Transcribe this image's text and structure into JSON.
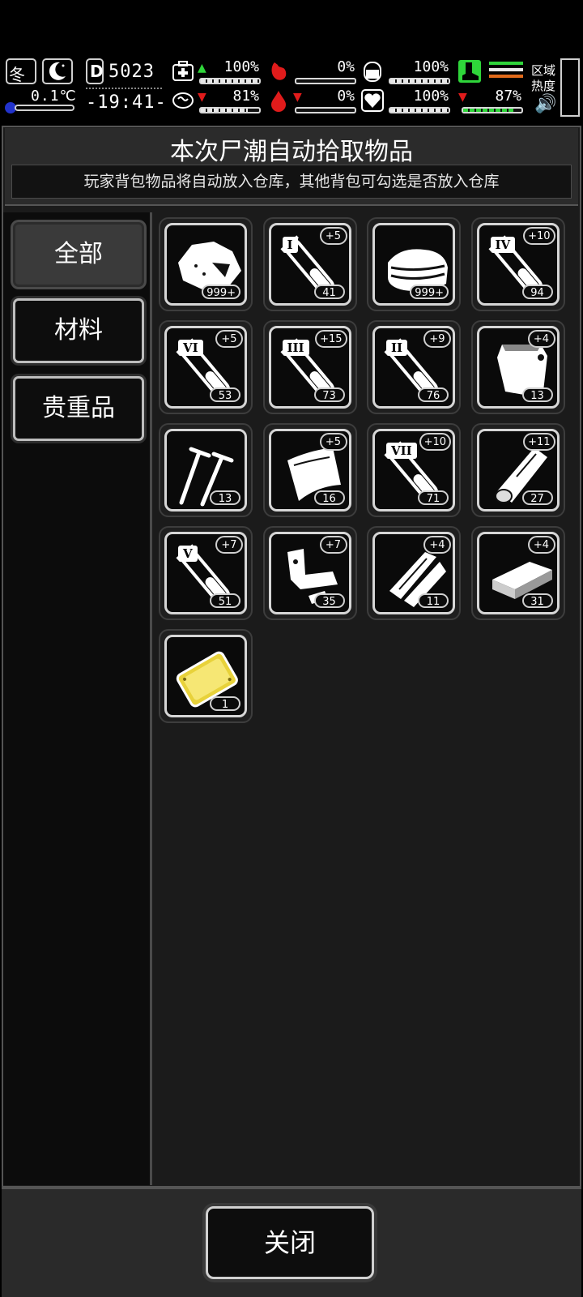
{
  "hud": {
    "season": "冬",
    "temperature": "0.1℃",
    "day": "5023",
    "time": "-19:41-",
    "stats": [
      {
        "name": "health",
        "value": "100%",
        "fill": 1.0,
        "trend": "up"
      },
      {
        "name": "stomach",
        "value": "0%",
        "fill": 0.0,
        "trend": ""
      },
      {
        "name": "hydration-tank",
        "value": "100%",
        "fill": 1.0,
        "trend": ""
      },
      {
        "name": "brain",
        "value": "81%",
        "fill": 0.81,
        "trend": "down"
      },
      {
        "name": "blood",
        "value": "0%",
        "fill": 0.0,
        "trend": "down"
      },
      {
        "name": "heart",
        "value": "100%",
        "fill": 1.0,
        "trend": ""
      },
      {
        "name": "stamina",
        "value": "87%",
        "fill": 0.87,
        "trend": "down"
      }
    ],
    "region_heat_label": "区域热度"
  },
  "dialog": {
    "title": "本次尸潮自动拾取物品",
    "subtitle": "玩家背包物品将自动放入仓库，其他背包可勾选是否放入仓库"
  },
  "tabs": [
    {
      "label": "全部",
      "active": true
    },
    {
      "label": "材料",
      "active": false
    },
    {
      "label": "贵重品",
      "active": false
    }
  ],
  "items": [
    {
      "icon": "rock-lump-icon",
      "count": "999+",
      "plus": "",
      "roman": ""
    },
    {
      "icon": "test-tube-icon",
      "count": "41",
      "plus": "+5",
      "roman": "I"
    },
    {
      "icon": "cloth-stack-icon",
      "count": "999+",
      "plus": "",
      "roman": ""
    },
    {
      "icon": "test-tube-icon",
      "count": "94",
      "plus": "+10",
      "roman": "IV"
    },
    {
      "icon": "test-tube-icon",
      "count": "53",
      "plus": "+5",
      "roman": "VI"
    },
    {
      "icon": "test-tube-icon",
      "count": "73",
      "plus": "+15",
      "roman": "III"
    },
    {
      "icon": "test-tube-icon",
      "count": "76",
      "plus": "+9",
      "roman": "II"
    },
    {
      "icon": "pouch-icon",
      "count": "13",
      "plus": "+4",
      "roman": ""
    },
    {
      "icon": "nails-icon",
      "count": "13",
      "plus": "",
      "roman": ""
    },
    {
      "icon": "fabric-sheet-icon",
      "count": "16",
      "plus": "+5",
      "roman": ""
    },
    {
      "icon": "test-tube-icon",
      "count": "71",
      "plus": "+10",
      "roman": "VII"
    },
    {
      "icon": "wood-log-icon",
      "count": "27",
      "plus": "+11",
      "roman": ""
    },
    {
      "icon": "test-tube-icon",
      "count": "51",
      "plus": "+7",
      "roman": "V"
    },
    {
      "icon": "scrap-metal-icon",
      "count": "35",
      "plus": "+7",
      "roman": ""
    },
    {
      "icon": "wood-planks-icon",
      "count": "11",
      "plus": "+4",
      "roman": ""
    },
    {
      "icon": "wood-block-icon",
      "count": "31",
      "plus": "+4",
      "roman": ""
    },
    {
      "icon": "gold-plate-icon",
      "count": "1",
      "plus": "",
      "roman": ""
    }
  ],
  "footer": {
    "close_label": "关闭"
  },
  "colors": {
    "accent_green": "#2fd53a",
    "danger_red": "#e01b1b",
    "gold": "#e8d23a",
    "temp_blue": "#2233cc"
  }
}
